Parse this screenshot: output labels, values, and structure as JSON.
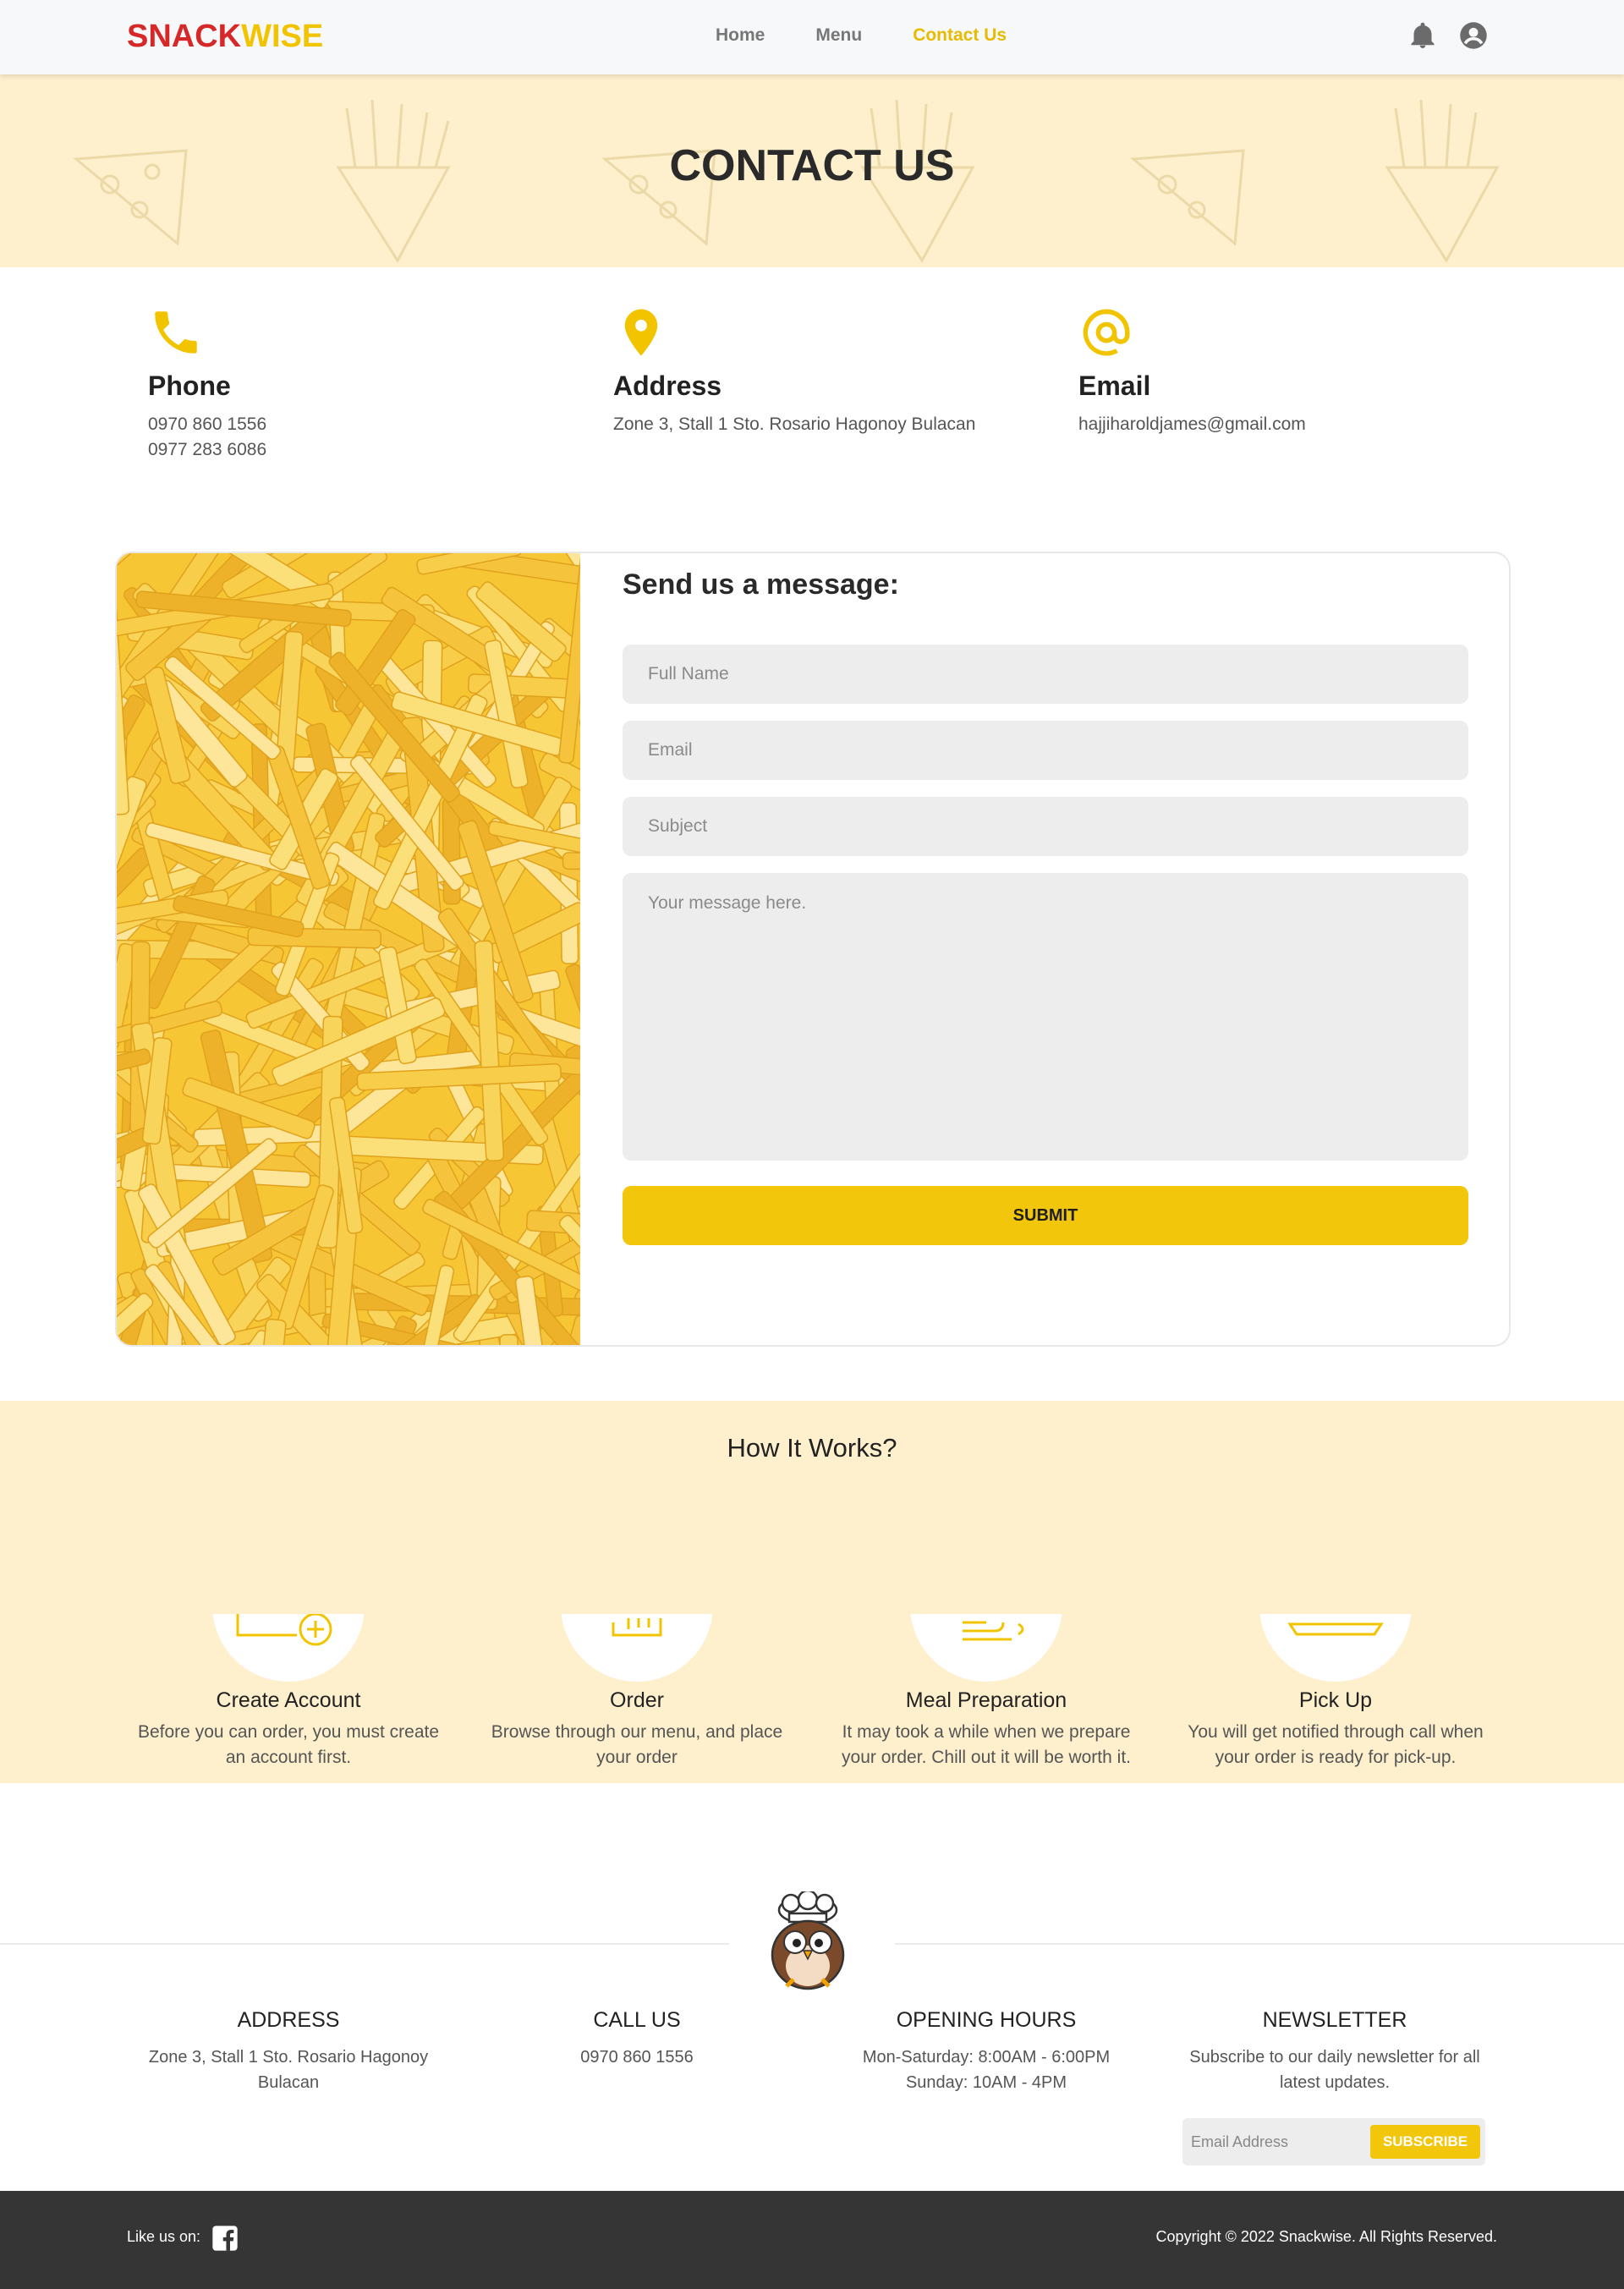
{
  "brand": {
    "part1": "SNACK",
    "part2": "WISE",
    "color_red": "#d62828",
    "color_yellow": "#f2c400"
  },
  "nav": {
    "links": [
      {
        "label": "Home",
        "active": false
      },
      {
        "label": "Menu",
        "active": false
      },
      {
        "label": "Contact Us",
        "active": true
      }
    ],
    "icons": [
      "bell-icon",
      "user-circle-icon"
    ]
  },
  "hero": {
    "title": "CONTACT US"
  },
  "contact": {
    "phone": {
      "title": "Phone",
      "lines": [
        "0970 860 1556",
        "0977 283 6086"
      ],
      "icon": "phone-icon"
    },
    "address": {
      "title": "Address",
      "lines": [
        "Zone 3, Stall 1 Sto. Rosario Hagonoy Bulacan"
      ],
      "icon": "map-pin-icon"
    },
    "email": {
      "title": "Email",
      "lines": [
        "hajjiharoldjames@gmail.com"
      ],
      "icon": "at-sign-icon"
    }
  },
  "form": {
    "title": "Send us a message:",
    "full_name_placeholder": "Full Name",
    "email_placeholder": "Email",
    "subject_placeholder": "Subject",
    "message_placeholder": "Your message here.",
    "submit_label": "SUBMIT"
  },
  "how_it_works": {
    "title": "How It Works?",
    "steps": [
      {
        "title": "Create Account",
        "desc_lines": [
          "Before you can order, you must create",
          "an account first."
        ],
        "icon": "add-account-icon"
      },
      {
        "title": "Order",
        "desc_lines": [
          "Browse through our menu, and place",
          "your order"
        ],
        "icon": "order-icon"
      },
      {
        "title": "Meal Preparation",
        "desc_lines": [
          "It may took a while when we prepare",
          "your order. Chill out it will be worth it."
        ],
        "icon": "cooking-icon"
      },
      {
        "title": "Pick Up",
        "desc_lines": [
          "You will get notified through call when",
          "your order is ready for pick-up."
        ],
        "icon": "pickup-icon"
      }
    ]
  },
  "footer": {
    "address": {
      "title": "ADDRESS",
      "lines": [
        "Zone 3, Stall 1 Sto. Rosario Hagonoy",
        "Bulacan"
      ]
    },
    "call": {
      "title": "CALL US",
      "lines": [
        "0970 860 1556"
      ]
    },
    "hours": {
      "title": "OPENING HOURS",
      "lines": [
        "Mon-Saturday: 8:00AM - 6:00PM",
        "Sunday: 10AM - 4PM"
      ]
    },
    "newsletter": {
      "title": "NEWSLETTER",
      "lines": [
        "Subscribe to our daily newsletter for all",
        "latest updates."
      ],
      "email_placeholder": "Email Address",
      "subscribe_label": "SUBSCRIBE"
    },
    "like_us": "Like us on:",
    "copyright": "Copyright © 2022 Snackwise. All Rights Reserved."
  },
  "colors": {
    "accent": "#f2c60a",
    "hero_bg": "#fef0cd",
    "footer_bg": "#353535"
  }
}
